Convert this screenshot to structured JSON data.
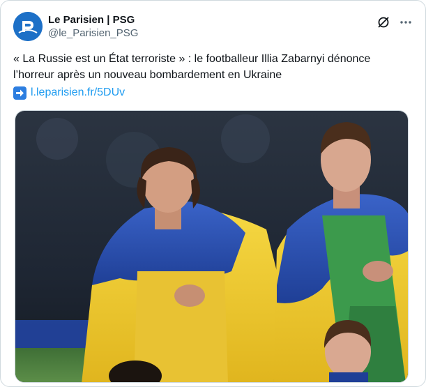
{
  "account": {
    "display_name": "Le Parisien | PSG",
    "handle": "@le_Parisien_PSG"
  },
  "post": {
    "text": "« La Russie est un État terroriste » : le footballeur Illia Zabarnyi dénonce l’horreur après un nouveau bombardement en Ukraine",
    "link_text": "l.leparisien.fr/5DUv",
    "link_emoji": "right-arrow-emoji"
  },
  "icons": {
    "grok": "grok-icon",
    "more": "more-icon"
  },
  "colors": {
    "link": "#1d9bf0",
    "avatar_bg": "#1d70c7",
    "flag_blue": "#2a55b8",
    "flag_yellow": "#f2cf2a",
    "pitch_green": "#4c8a3e"
  }
}
